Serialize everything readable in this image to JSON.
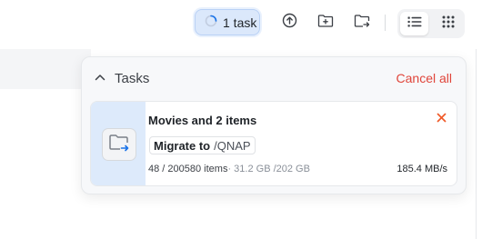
{
  "toolbar": {
    "task_chip_label": "1 task",
    "buttons": [
      {
        "icon": "upload-icon"
      },
      {
        "icon": "new-folder-icon"
      },
      {
        "icon": "move-to-folder-icon"
      }
    ],
    "view_modes": [
      {
        "icon": "list-view-icon",
        "active": true
      },
      {
        "icon": "grid-view-icon",
        "active": false
      }
    ]
  },
  "tasks_panel": {
    "title": "Tasks",
    "cancel_all_label": "Cancel all",
    "tasks": [
      {
        "title": "Movies and 2 items",
        "action_label": "Migrate to",
        "destination": "/QNAP",
        "items_progress": "48 / 200580 items",
        "size_progress": "· 31.2 GB /202 GB",
        "speed": "185.4 MB/s"
      }
    ]
  },
  "colors": {
    "accent": "#1a73e8",
    "danger": "#e0453a",
    "close_icon": "#f05a28",
    "chip_bg": "#dbe8fb",
    "thumb_bg": "#ddeafb"
  }
}
